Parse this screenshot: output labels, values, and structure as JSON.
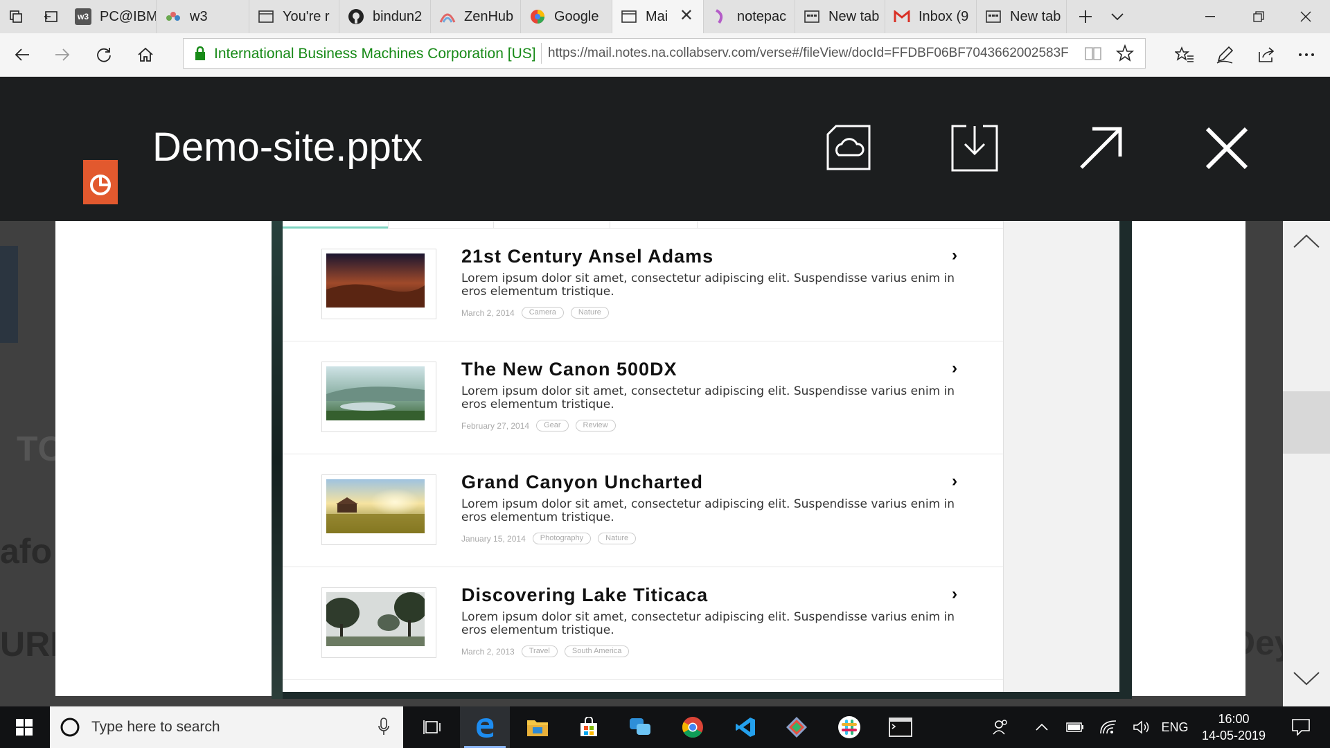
{
  "browser": {
    "tabs": [
      {
        "label": "PC@IBM",
        "icon": "w3-icon",
        "icon_text": "w3"
      },
      {
        "label": "w3",
        "icon": "ibm-bee-icon"
      },
      {
        "label": "You're r",
        "icon": "page-icon"
      },
      {
        "label": "bindun2",
        "icon": "github-icon"
      },
      {
        "label": "ZenHub",
        "icon": "zenhub-icon"
      },
      {
        "label": "Google",
        "icon": "google-icon"
      },
      {
        "label": "Mai",
        "icon": "page-icon",
        "active": true
      },
      {
        "label": "notepac",
        "icon": "notepad-icon"
      },
      {
        "label": "New tab",
        "icon": "newtab-icon"
      },
      {
        "label": "Inbox (9",
        "icon": "gmail-icon"
      },
      {
        "label": "New tab",
        "icon": "newtab-icon"
      }
    ],
    "address": {
      "certificate": "International Business Machines Corporation [US]",
      "url": "https://mail.notes.na.collabserv.com/verse#/fileView/docId=FFDBF06BF7043662002583F"
    }
  },
  "viewer": {
    "title": "Demo-site.pptx",
    "file_type_icon": "powerpoint-icon",
    "actions": [
      "cloud-save",
      "download",
      "open-external",
      "close"
    ]
  },
  "background_fragments": [
    "TC",
    "afo",
    "URL",
    "Dey"
  ],
  "slide": {
    "posts": [
      {
        "title": "21st Century Ansel Adams",
        "desc": "Lorem ipsum dolor sit amet, consectetur adipiscing elit. Suspendisse varius enim in eros elementum tristique.",
        "date": "March 2, 2014",
        "tags": [
          "Camera",
          "Nature"
        ],
        "thumb": "desert-dusk"
      },
      {
        "title": "The New Canon 500DX",
        "desc": "Lorem ipsum dolor sit amet, consectetur adipiscing elit. Suspendisse varius enim in eros elementum tristique.",
        "date": "February 27, 2014",
        "tags": [
          "Gear",
          "Review"
        ],
        "thumb": "misty-lake"
      },
      {
        "title": "Grand Canyon Uncharted",
        "desc": "Lorem ipsum dolor sit amet, consectetur adipiscing elit. Suspendisse varius enim in eros elementum tristique.",
        "date": "January 15, 2014",
        "tags": [
          "Photography",
          "Nature"
        ],
        "thumb": "sunset-field"
      },
      {
        "title": "Discovering Lake Titicaca",
        "desc": "Lorem ipsum dolor sit amet, consectetur adipiscing elit. Suspendisse varius enim in eros elementum tristique.",
        "date": "March 2, 2013",
        "tags": [
          "Travel",
          "South America"
        ],
        "thumb": "foggy-trees"
      }
    ]
  },
  "taskbar": {
    "search_placeholder": "Type here to search",
    "language": "ENG",
    "time": "16:00",
    "date": "14-05-2019"
  }
}
